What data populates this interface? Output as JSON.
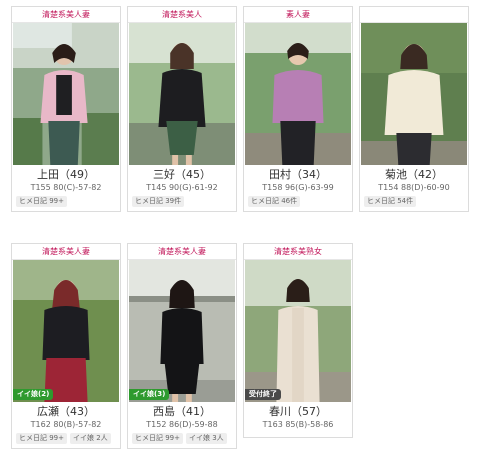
{
  "cards": [
    {
      "category": "清楚系美人妻",
      "name": "上田（49）",
      "spec": "T155 80(C)-57-82",
      "tags": [
        "ヒメ日記 99+"
      ],
      "badge": ""
    },
    {
      "category": "清楚系美人",
      "name": "三好（45）",
      "spec": "T145 90(G)-61-92",
      "tags": [
        "ヒメ日記 39件"
      ],
      "badge": ""
    },
    {
      "category": "素人妻",
      "name": "田村（34）",
      "spec": "T158 96(G)-63-99",
      "tags": [
        "ヒメ日記 46件"
      ],
      "badge": ""
    },
    {
      "category": "",
      "name": "菊池（42）",
      "spec": "T154 88(D)-60-90",
      "tags": [
        "ヒメ日記 54件"
      ],
      "badge": ""
    },
    {
      "category": "清楚系美人妻",
      "name": "広瀬（43）",
      "spec": "T162 80(B)-57-82",
      "tags": [
        "ヒメ日記 99+",
        "イイ娘 2人"
      ],
      "badge": "イイ娘(2)"
    },
    {
      "category": "清楚系美人妻",
      "name": "西島（41）",
      "spec": "T152 86(D)-59-88",
      "tags": [
        "ヒメ日記 99+",
        "イイ娘 3人"
      ],
      "badge": "イイ娘(3)"
    },
    {
      "category": "清楚系美熟女",
      "name": "春川（57）",
      "spec": "T163 85(B)-58-86",
      "tags": [],
      "badge": "受付終了"
    }
  ],
  "colors": {
    "category_text": "#c2185b",
    "badge_green": "#2e9a2e",
    "badge_gray": "#4a4a4a"
  }
}
